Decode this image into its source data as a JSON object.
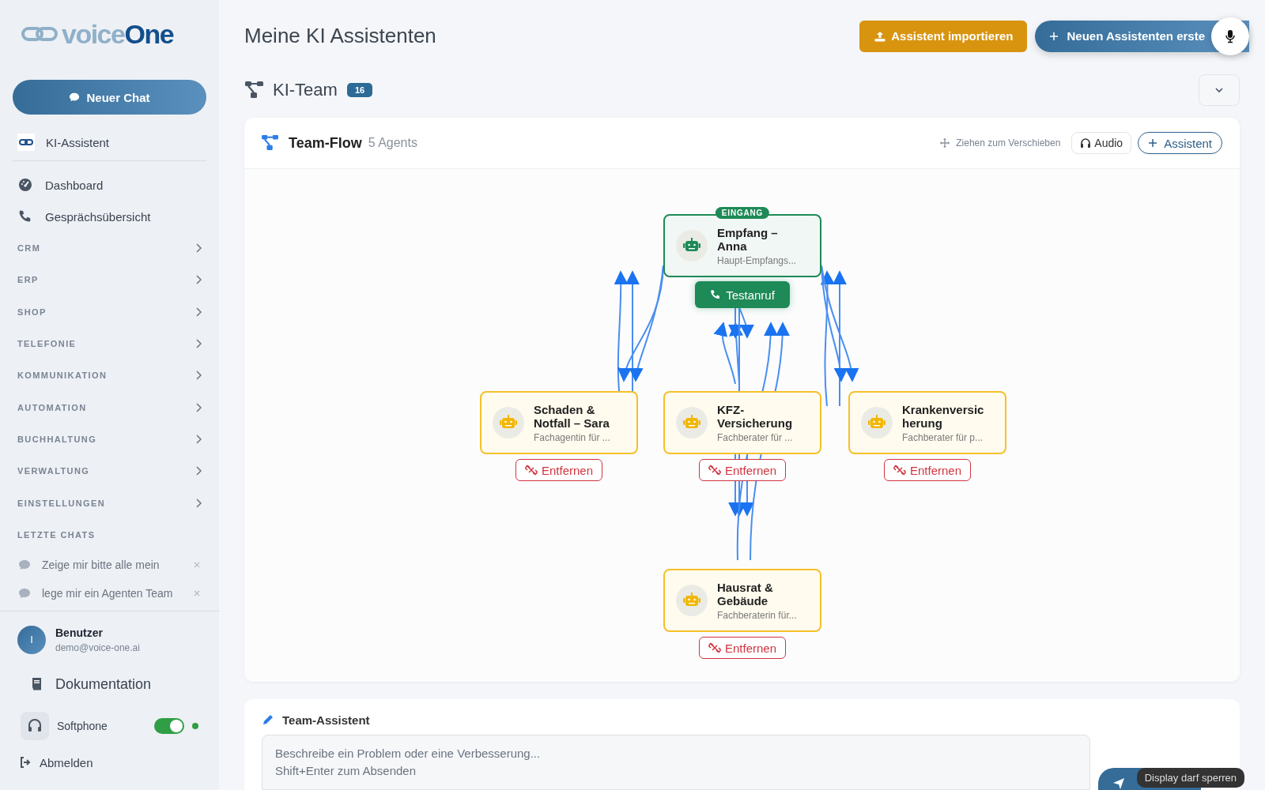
{
  "sidebar": {
    "logo": {
      "part_1": "voice",
      "part_2": "One"
    },
    "new_chat": "Neuer Chat",
    "assistant_link": "KI-Assistent",
    "nav": [
      {
        "label": "Dashboard",
        "kind": "dashboard"
      },
      {
        "label": "Gesprächsübersicht",
        "kind": "phone"
      }
    ],
    "sections": [
      "CRM",
      "ERP",
      "SHOP",
      "TELEFONIE",
      "KOMMUNIKATION",
      "AUTOMATION",
      "BUCHHALTUNG",
      "VERWALTUNG",
      "EINSTELLUNGEN"
    ],
    "recent_title": "LETZTE CHATS",
    "recent_chats": [
      "Zeige mir bitte alle mein",
      "lege mir ein Agenten Team"
    ],
    "user": {
      "initial": "I",
      "name": "Benutzer",
      "email": "demo@voice-one.ai"
    },
    "docs": "Dokumentation",
    "softphone": {
      "label": "Softphone",
      "on": true
    },
    "logout": "Abmelden"
  },
  "header": {
    "title": "Meine KI Assistenten",
    "import_button": "Assistent importieren",
    "create_button": "Neuen Assistenten erste"
  },
  "team": {
    "title": "KI-Team",
    "count": "16"
  },
  "flow": {
    "title": "Team-Flow",
    "count": "5 Agents",
    "hint": "Ziehen zum Verschieben",
    "audio_button": "Audio",
    "add_button": "Assistent",
    "test_call_button": "Testanruf",
    "nodes": [
      {
        "kind": "entry",
        "badge": "EINGANG",
        "name": "Empfang – Anna",
        "description": "Haupt-Empfangs..."
      },
      {
        "kind": "agent",
        "name": "Schaden & Notfall – Sara",
        "description": "Fachagentin für ...",
        "remove_button": "Entfernen"
      },
      {
        "kind": "agent",
        "name": "KFZ-Versicherung",
        "description": "Fachberater für ...",
        "remove_button": "Entfernen"
      },
      {
        "kind": "agent",
        "name": "Krankenversic herung",
        "description": "Fachberater für p...",
        "remove_button": "Entfernen"
      },
      {
        "kind": "agent",
        "name": "Hausrat & Gebäude",
        "description": "Fachberaterin für...",
        "remove_button": "Entfernen"
      }
    ]
  },
  "assistant_panel": {
    "title": "Team-Assistent",
    "placeholder": "Beschreibe ein Problem oder eine Verbesserung...\nShift+Enter zum Absenden"
  },
  "toast": "Display darf sperren"
}
